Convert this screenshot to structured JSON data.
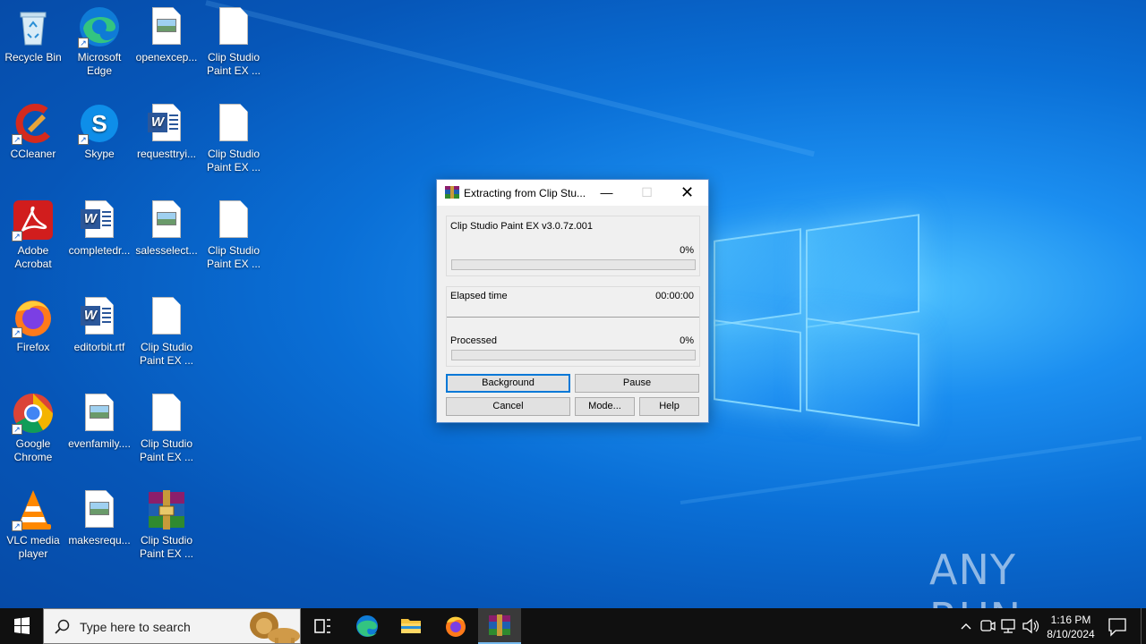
{
  "desktop": {
    "icons": [
      {
        "label": "Recycle Bin"
      },
      {
        "label": "Microsoft Edge"
      },
      {
        "label": "openexcep..."
      },
      {
        "label": "Clip Studio Paint EX ..."
      },
      {
        "label": "CCleaner"
      },
      {
        "label": "Skype"
      },
      {
        "label": "requesttryi..."
      },
      {
        "label": "Clip Studio Paint EX ..."
      },
      {
        "label": "Adobe Acrobat"
      },
      {
        "label": "completedr..."
      },
      {
        "label": "salesselect..."
      },
      {
        "label": "Clip Studio Paint EX ..."
      },
      {
        "label": "Firefox"
      },
      {
        "label": "editorbit.rtf"
      },
      {
        "label": "Clip Studio Paint EX ..."
      },
      {
        "label": "Google Chrome"
      },
      {
        "label": "evenfamily...."
      },
      {
        "label": "Clip Studio Paint EX ..."
      },
      {
        "label": "VLC media player"
      },
      {
        "label": "makesrequ..."
      },
      {
        "label": "Clip Studio Paint EX ..."
      }
    ]
  },
  "dialog": {
    "title": "Extracting from Clip Stu...",
    "archive_name": "Clip Studio Paint EX v3.0.7z.001",
    "file_percent": "0%",
    "elapsed_label": "Elapsed time",
    "elapsed_value": "00:00:00",
    "processed_label": "Processed",
    "processed_percent": "0%",
    "file_progress": 0,
    "processed_progress": 0,
    "buttons": {
      "background": "Background",
      "pause": "Pause",
      "cancel": "Cancel",
      "mode": "Mode...",
      "help": "Help"
    }
  },
  "taskbar": {
    "search_placeholder": "Type here to search",
    "time": "1:16 PM",
    "date": "8/10/2024"
  },
  "watermark": "ANY RUN"
}
